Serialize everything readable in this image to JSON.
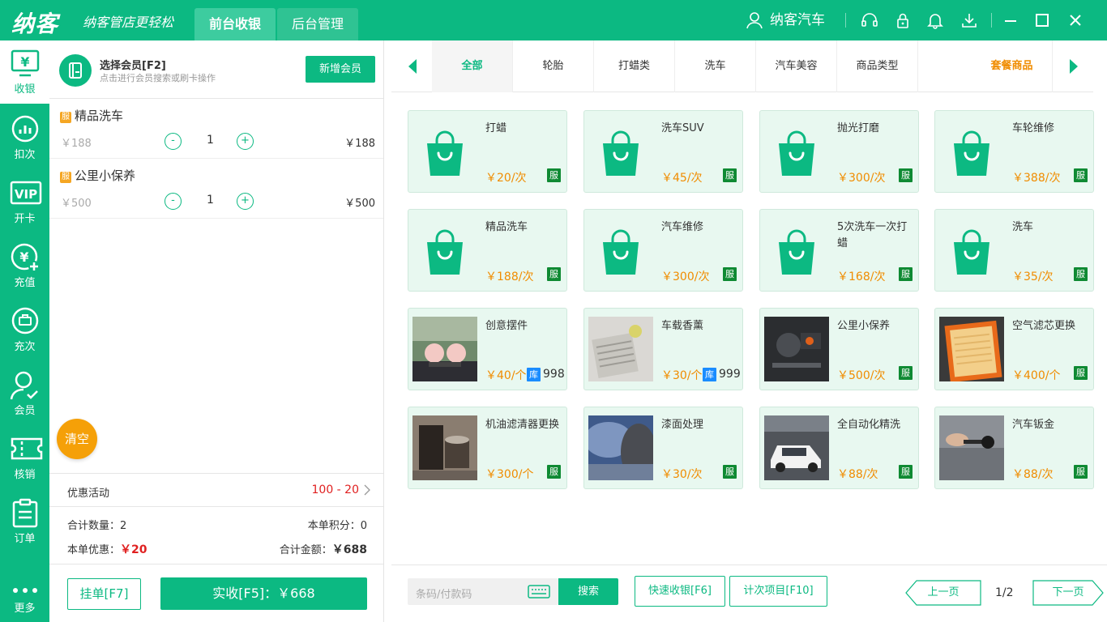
{
  "header": {
    "logo": "纳客",
    "slogan": "纳客管店更轻松",
    "tabs": [
      {
        "label": "前台收银"
      },
      {
        "label": "后台管理"
      }
    ],
    "user_name": "纳客汽车"
  },
  "sidebar": {
    "items": [
      {
        "label": "收银",
        "icon": "cashier-icon"
      },
      {
        "label": "扣次",
        "icon": "chart-icon"
      },
      {
        "label": "开卡",
        "icon": "vip-icon"
      },
      {
        "label": "充值",
        "icon": "recharge-icon"
      },
      {
        "label": "充次",
        "icon": "recharge-times-icon"
      },
      {
        "label": "会员",
        "icon": "member-icon"
      },
      {
        "label": "核销",
        "icon": "ticket-icon"
      },
      {
        "label": "订单",
        "icon": "order-icon"
      },
      {
        "label": "更多",
        "icon": "more-icon"
      }
    ]
  },
  "cart": {
    "member_title": "选择会员[F2]",
    "member_subtitle": "点击进行会员搜索或刷卡操作",
    "add_member": "新增会员",
    "badge_service": "服",
    "items": [
      {
        "name": "精品洗车",
        "price": "￥188",
        "qty": "1",
        "total": "￥188",
        "minus": "-",
        "plus": "+"
      },
      {
        "name": "公里小保养",
        "price": "￥500",
        "qty": "1",
        "total": "￥500",
        "minus": "-",
        "plus": "+"
      }
    ],
    "clear": "清空",
    "promo_label": "优惠活动",
    "promo_value": "100 - 20",
    "count_label": "合计数量：",
    "count_value": "2",
    "points_label": "本单积分：",
    "points_value": "0",
    "discount_label": "本单优惠：",
    "discount_value": "￥20",
    "total_label": "合计金额：",
    "total_value": "￥688",
    "hold_button": "挂单[F7]",
    "pay_button": "实收[F5]：￥668"
  },
  "categories": [
    "全部",
    "轮胎",
    "打蜡类",
    "洗车",
    "汽车美容",
    "商品类型",
    "套餐商品"
  ],
  "products": [
    {
      "name": "打蜡",
      "price": "￥20/次",
      "badge": "服",
      "img": "bag"
    },
    {
      "name": "洗车SUV",
      "price": "￥45/次",
      "badge": "服",
      "img": "bag"
    },
    {
      "name": "抛光打磨",
      "price": "￥300/次",
      "badge": "服",
      "img": "bag"
    },
    {
      "name": "车轮维修",
      "price": "￥388/次",
      "badge": "服",
      "img": "bag"
    },
    {
      "name": "精品洗车",
      "price": "￥188/次",
      "badge": "服",
      "img": "bag"
    },
    {
      "name": "汽车维修",
      "price": "￥300/次",
      "badge": "服",
      "img": "bag"
    },
    {
      "name": "5次洗车一次打蜡",
      "price": "￥168/次",
      "badge": "服",
      "img": "bag"
    },
    {
      "name": "洗车",
      "price": "￥35/次",
      "badge": "服",
      "img": "bag"
    },
    {
      "name": "创意摆件",
      "price": "￥40/个",
      "badge": "库",
      "stock": "998",
      "img": "photo-pigs"
    },
    {
      "name": "车载香薰",
      "price": "￥30/个",
      "badge": "库",
      "stock": "999",
      "img": "photo-vent"
    },
    {
      "name": "公里小保养",
      "price": "￥500/次",
      "badge": "服",
      "img": "photo-engine"
    },
    {
      "name": "空气滤芯更换",
      "price": "￥400/个",
      "badge": "服",
      "img": "photo-filter"
    },
    {
      "name": "机油滤清器更换",
      "price": "￥300/个",
      "badge": "服",
      "img": "photo-oil"
    },
    {
      "name": "漆面处理",
      "price": "￥30/次",
      "badge": "服",
      "img": "photo-paint"
    },
    {
      "name": "全自动化精洗",
      "price": "￥88/次",
      "badge": "服",
      "img": "photo-car"
    },
    {
      "name": "汽车钣金",
      "price": "￥88/次",
      "badge": "服",
      "img": "photo-dent"
    }
  ],
  "bottom": {
    "scan_placeholder": "条码/付款码",
    "search": "搜索",
    "quick_pay": "快速收银[F6]",
    "count_items": "计次项目[F10]",
    "prev": "上一页",
    "page": "1/2",
    "next": "下一页"
  },
  "colors": {
    "primary": "#0cb982",
    "accent": "#f08c00",
    "danger": "#e02020"
  }
}
